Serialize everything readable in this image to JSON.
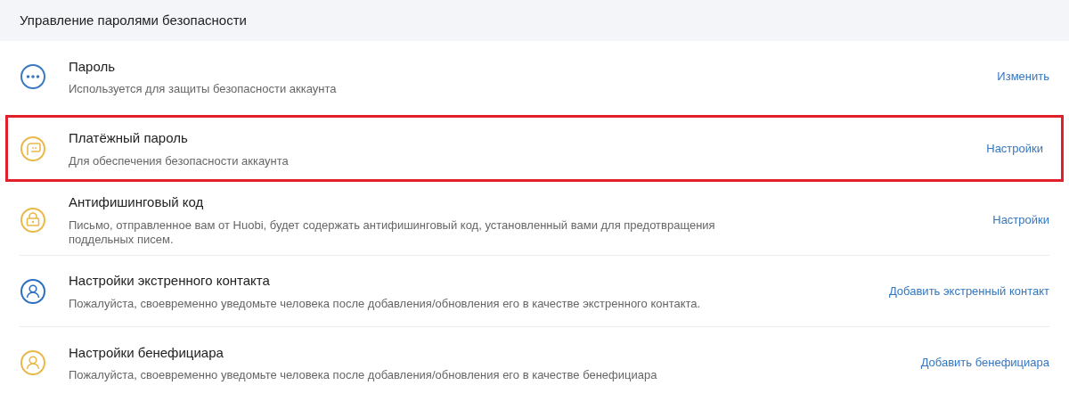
{
  "header": {
    "title": "Управление паролями безопасности"
  },
  "rows": [
    {
      "kind": "dots",
      "color": "#3a78c2",
      "title": "Пароль",
      "description": "Используется для защиты безопасности аккаунта",
      "action": "Изменить",
      "highlighted": false
    },
    {
      "kind": "chat",
      "color": "#e9b949",
      "title": "Платёжный пароль",
      "description": "Для обеспечения безопасности аккаунта",
      "action": "Настройки",
      "highlighted": true
    },
    {
      "kind": "lock",
      "color": "#e9b949",
      "title": "Антифишинговый код",
      "description": "Письмо, отправленное вам от Huobi, будет содержать антифишинговый код, установленный вами для предотвращения поддельных писем.",
      "action": "Настройки",
      "highlighted": false
    },
    {
      "kind": "person",
      "color": "#2a6fc0",
      "title": "Настройки экстренного контакта",
      "description": "Пожалуйста, своевременно уведомьте человека после добавления/обновления его в качестве экстренного контакта.",
      "action": "Добавить экстренный контакт",
      "highlighted": false
    },
    {
      "kind": "person",
      "color": "#e9b949",
      "title": "Настройки бенефициара",
      "description": "Пожалуйста, своевременно уведомьте человека после добавления/обновления его в качестве бенефициара",
      "action": "Добавить бенефициара",
      "highlighted": false
    }
  ]
}
